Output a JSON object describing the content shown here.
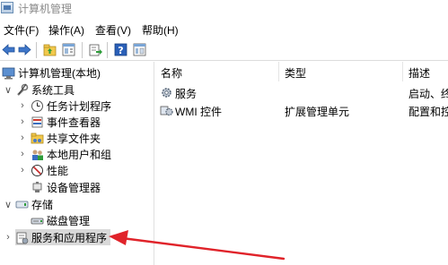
{
  "window": {
    "title": "计算机管理"
  },
  "menu": [
    "文件(F)",
    "操作(A)",
    "查看(V)",
    "帮助(H)"
  ],
  "toolbar": {
    "buttons": [
      "back-arrow-icon",
      "forward-arrow-icon",
      "up-folder-icon",
      "show-tree-icon",
      "export-icon",
      "help-icon",
      "properties-icon"
    ]
  },
  "tree": {
    "root": "计算机管理(本地)",
    "system_tools": "系统工具",
    "task_scheduler": "任务计划程序",
    "event_viewer": "事件查看器",
    "shared_folders": "共享文件夹",
    "local_users": "本地用户和组",
    "performance": "性能",
    "device_manager": "设备管理器",
    "storage": "存储",
    "disk_management": "磁盘管理",
    "services_apps": "服务和应用程序"
  },
  "list": {
    "columns": [
      "名称",
      "类型",
      "描述"
    ],
    "rows": [
      {
        "name": "服务",
        "type": "",
        "desc": "启动、终"
      },
      {
        "name": "WMI 控件",
        "type": "扩展管理单元",
        "desc": "配置和控"
      }
    ]
  },
  "colors": {
    "annotation_arrow": "#e0232a",
    "selected_bg": "#d9d9d9"
  }
}
